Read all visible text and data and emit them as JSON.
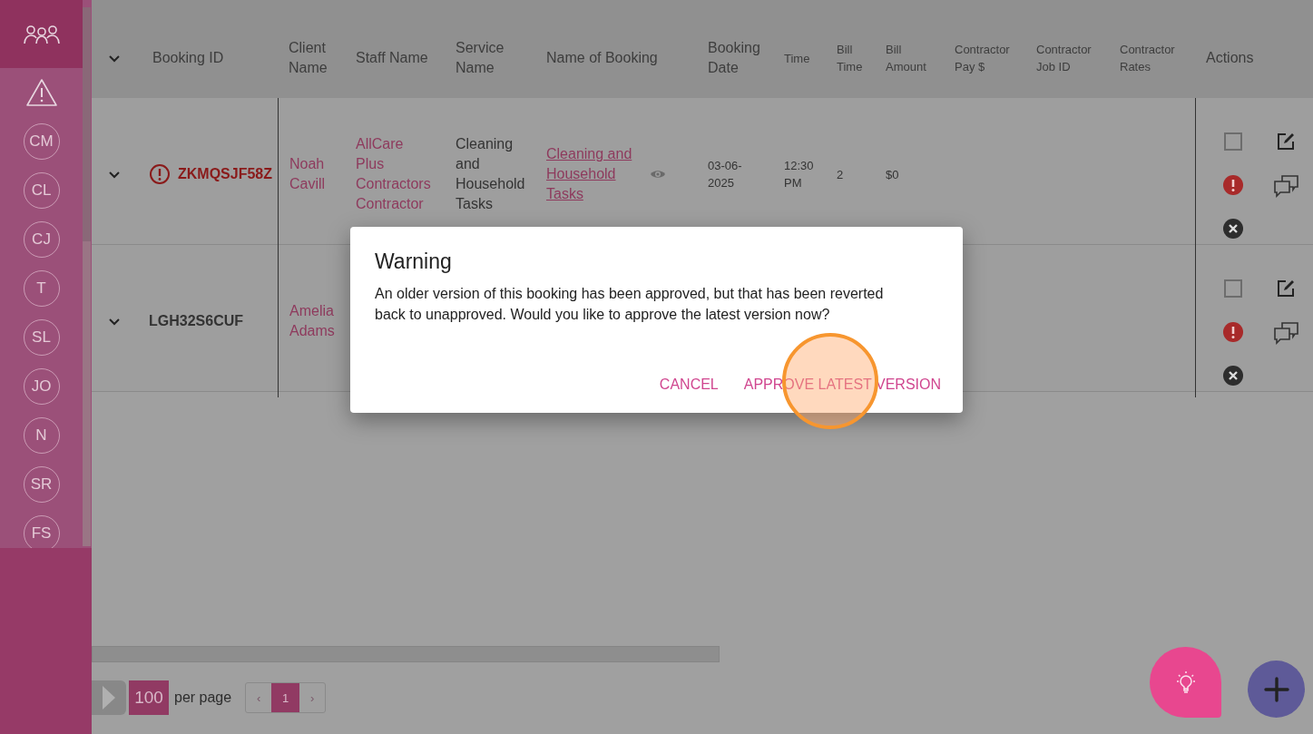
{
  "sidebar": {
    "items": [
      {
        "kind": "team",
        "selected": true
      },
      {
        "kind": "alert",
        "selected": false
      },
      {
        "kind": "initials",
        "label": "CM",
        "selected": false
      },
      {
        "kind": "initials",
        "label": "CL",
        "selected": false
      },
      {
        "kind": "initials",
        "label": "CJ",
        "selected": false
      },
      {
        "kind": "initials",
        "label": "T",
        "selected": false
      },
      {
        "kind": "initials",
        "label": "SL",
        "selected": false
      },
      {
        "kind": "initials",
        "label": "JO",
        "selected": false
      },
      {
        "kind": "initials",
        "label": "N",
        "selected": false
      },
      {
        "kind": "initials",
        "label": "SR",
        "selected": false
      },
      {
        "kind": "initials",
        "label": "FS",
        "selected": false
      }
    ]
  },
  "table": {
    "columns": [
      "Booking ID",
      "Client Name",
      "Staff Name",
      "Service Name",
      "Name of Booking",
      "Booking Date",
      "Time",
      "Bill Time",
      "Bill Amount",
      "Contractor Pay $",
      "Contractor Job ID",
      "Contractor Rates",
      "Actions"
    ],
    "rows": [
      {
        "booking_id": "ZKMQSJF58Z",
        "flagged": true,
        "client": "Noah Cavill",
        "staff": "AllCare Plus Contractors Contractor",
        "service": "Cleaning and Household Tasks",
        "booking_name": "Cleaning and Household Tasks",
        "date": "03-06-2025",
        "time": "12:30 PM",
        "bill_time": "2",
        "bill_amount": "$0",
        "checked": false
      },
      {
        "booking_id": "LGH32S6CUF",
        "flagged": false,
        "client": "Amelia Adams",
        "checked": false
      }
    ]
  },
  "pagination": {
    "per_page": "100",
    "per_page_label": "per page",
    "prev": "‹",
    "next": "›",
    "pages": [
      {
        "label": "1",
        "selected": true
      }
    ]
  },
  "dialog": {
    "title": "Warning",
    "message": "An older version of this booking has been approved, but that has been reverted back to unapproved. Would you like to approve the latest version now?",
    "buttons": [
      {
        "label": "CANCEL",
        "highlighted": false
      },
      {
        "label": "APPROVE LATEST VERSION",
        "highlighted": true
      }
    ]
  }
}
